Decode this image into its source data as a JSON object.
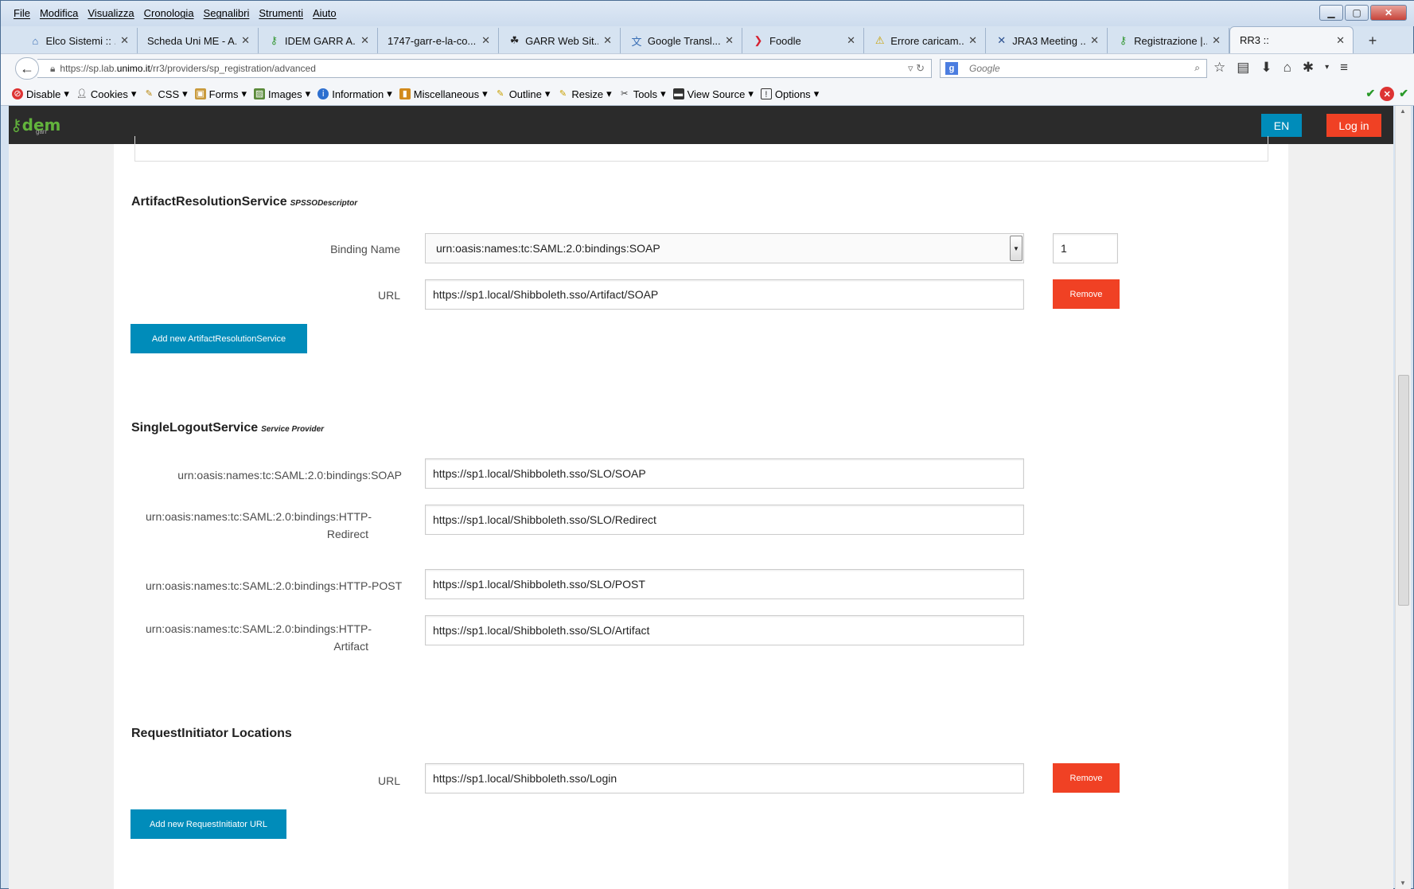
{
  "menubar": {
    "items": [
      "File",
      "Modifica",
      "Visualizza",
      "Cronologia",
      "Segnalibri",
      "Strumenti",
      "Aiuto"
    ]
  },
  "tabs": [
    {
      "title": "Elco Sistemi :: ...",
      "icon": "globe-icon"
    },
    {
      "title": "Scheda Uni ME - A...",
      "icon": "blank-icon"
    },
    {
      "title": "IDEM GARR A...",
      "icon": "idem-key-icon"
    },
    {
      "title": "1747-garr-e-la-co...",
      "icon": "blank-icon"
    },
    {
      "title": "GARR Web Sit...",
      "icon": "garr-icon"
    },
    {
      "title": "Google Transl...",
      "icon": "translate-icon"
    },
    {
      "title": "Foodle",
      "icon": "foodle-icon"
    },
    {
      "title": "Errore caricam...",
      "icon": "warning-icon"
    },
    {
      "title": "JRA3 Meeting ...",
      "icon": "jra3-icon"
    },
    {
      "title": "Registrazione |...",
      "icon": "idem-key-icon"
    },
    {
      "title": "RR3 ::",
      "icon": "blank-icon"
    }
  ],
  "nav": {
    "url_pre": "https://sp.lab.",
    "url_domain": "unimo.it",
    "url_post": "/rr3/providers/sp_registration/advanced",
    "search_placeholder": "Google"
  },
  "devbar": {
    "items": [
      "Disable",
      "Cookies",
      "CSS",
      "Forms",
      "Images",
      "Information",
      "Miscellaneous",
      "Outline",
      "Resize",
      "Tools",
      "View Source",
      "Options"
    ]
  },
  "header": {
    "lang": "EN",
    "login": "Log in"
  },
  "ars": {
    "title": "ArtifactResolutionService",
    "subtitle": "SPSSODescriptor",
    "binding_label": "Binding Name",
    "binding_value": "urn:oasis:names:tc:SAML:2.0:bindings:SOAP",
    "index_value": "1",
    "url_label": "URL",
    "url_value": "https://sp1.local/Shibboleth.sso/Artifact/SOAP",
    "remove": "Remove",
    "add": "Add new ArtifactResolutionService"
  },
  "slo": {
    "title": "SingleLogoutService",
    "subtitle": "Service Provider",
    "rows": [
      {
        "label": "urn:oasis:names:tc:SAML:2.0:bindings:SOAP",
        "value": "https://sp1.local/Shibboleth.sso/SLO/SOAP"
      },
      {
        "label": "urn:oasis:names:tc:SAML:2.0:bindings:HTTP-Redirect",
        "value": "https://sp1.local/Shibboleth.sso/SLO/Redirect"
      },
      {
        "label": "urn:oasis:names:tc:SAML:2.0:bindings:HTTP-POST",
        "value": "https://sp1.local/Shibboleth.sso/SLO/POST"
      },
      {
        "label": "urn:oasis:names:tc:SAML:2.0:bindings:HTTP-Artifact",
        "value": "https://sp1.local/Shibboleth.sso/SLO/Artifact"
      }
    ]
  },
  "ri": {
    "title": "RequestInitiator Locations",
    "url_label": "URL",
    "url_value": "https://sp1.local/Shibboleth.sso/Login",
    "remove": "Remove",
    "add": "Add new RequestInitiator URL"
  }
}
